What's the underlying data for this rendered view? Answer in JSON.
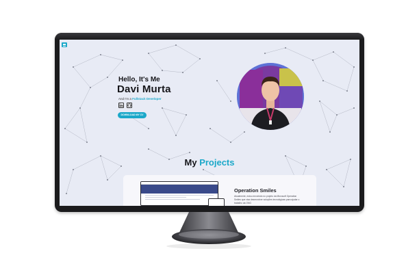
{
  "hero": {
    "greeting": "Hello, It's Me",
    "name": "Davi Murta",
    "role_prefix": "And I'm a",
    "role_highlight": "Fullstack Developer",
    "cv_button": "DOWNLOAD MY CV"
  },
  "social": [
    {
      "icon": "linkedin-icon",
      "label": "in"
    },
    {
      "icon": "github-icon"
    }
  ],
  "projects": {
    "title_prefix": "My",
    "title_highlight": "Projects",
    "items": [
      {
        "title": "Operation Smiles",
        "description": "Atualmente, estou envolvido no projeto da Microsoft Operation Smiles que visa desenvolver soluções tecnológicas para ajudar o trabalho da ONG"
      }
    ]
  },
  "colors": {
    "accent": "#1ba8c9",
    "screen_bg": "#e8ebf5",
    "avatar_ring": "#5e72d6",
    "bezel": "#1b1b1d"
  },
  "icons": [
    "menu-icon",
    "linkedin-icon",
    "github-icon"
  ]
}
